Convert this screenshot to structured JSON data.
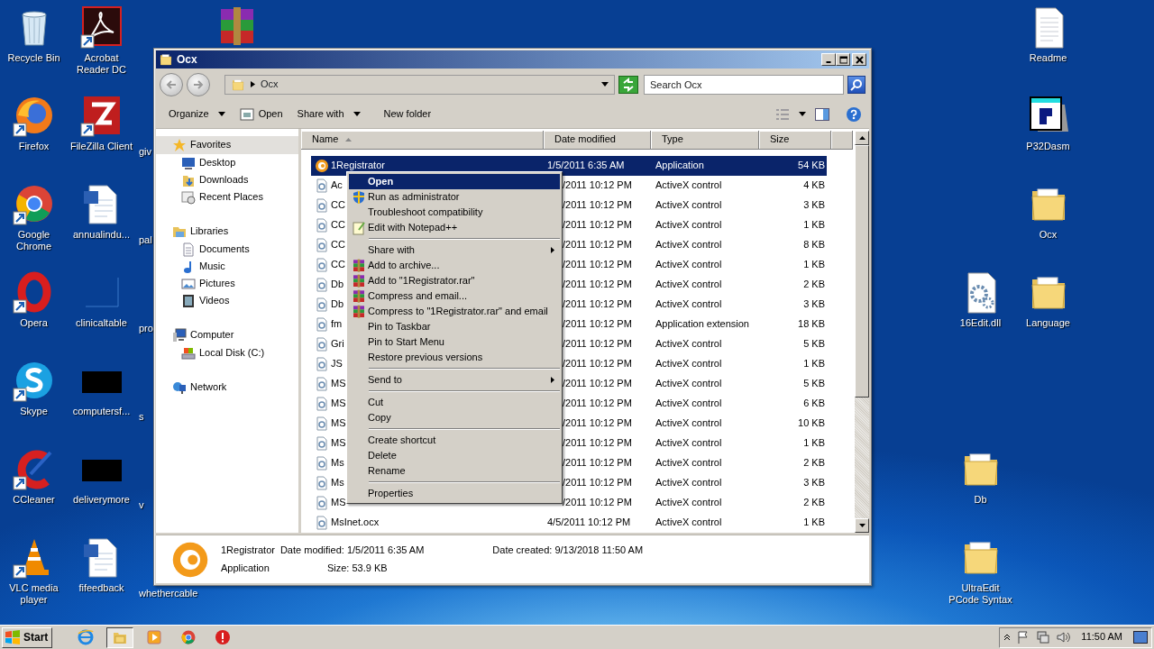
{
  "desktop": {
    "left_columns": [
      [
        {
          "label": "Recycle Bin",
          "kind": "recycle",
          "shortcut": false
        },
        {
          "label": "Firefox",
          "kind": "firefox",
          "shortcut": true
        },
        {
          "label": "Google Chrome",
          "kind": "chrome",
          "shortcut": true
        },
        {
          "label": "Opera",
          "kind": "opera",
          "shortcut": true
        },
        {
          "label": "Skype",
          "kind": "skype",
          "shortcut": true
        },
        {
          "label": "CCleaner",
          "kind": "ccleaner",
          "shortcut": true
        },
        {
          "label": "VLC media player",
          "kind": "vlc",
          "shortcut": true
        }
      ],
      [
        {
          "label": "Acrobat Reader DC",
          "kind": "acrobat",
          "shortcut": true
        },
        {
          "label": "FileZilla Client",
          "kind": "filezilla",
          "shortcut": true
        },
        {
          "label": "annualindu...",
          "kind": "word",
          "shortcut": false
        },
        {
          "label": "clinicaltable",
          "kind": "blank",
          "shortcut": false
        },
        {
          "label": "computersf...",
          "kind": "black",
          "shortcut": false
        },
        {
          "label": "deliverymore",
          "kind": "black",
          "shortcut": false
        },
        {
          "label": "fifeedback",
          "kind": "word",
          "shortcut": false
        }
      ],
      [
        null,
        {
          "label": "giv"
        },
        {
          "label": "pal"
        },
        {
          "label": "pro"
        },
        {
          "label": "s"
        },
        {
          "label": "v"
        },
        {
          "label": "whethercable"
        }
      ],
      [
        {
          "kind": "winrar",
          "shortcut": false
        }
      ]
    ],
    "right_columns": [
      [
        null,
        null,
        null,
        {
          "label": "16Edit.dll",
          "kind": "dll",
          "shortcut": false
        },
        null,
        {
          "label": "Db",
          "kind": "folder",
          "shortcut": false
        },
        {
          "label": "UltraEdit PCode Syntax",
          "kind": "folder",
          "shortcut": false
        }
      ],
      [
        {
          "label": "Readme",
          "kind": "text",
          "shortcut": false
        },
        {
          "label": "P32Dasm",
          "kind": "p32",
          "shortcut": false
        },
        {
          "label": "Ocx",
          "kind": "folder",
          "shortcut": false
        },
        {
          "label": "Language",
          "kind": "folder",
          "shortcut": false
        }
      ]
    ]
  },
  "window": {
    "title": "Ocx",
    "address": "Ocx",
    "search": {
      "placeholder": "Search Ocx"
    },
    "toolbar": [
      {
        "label": "Organize",
        "kind": "menu"
      },
      {
        "label": "Open",
        "kind": "icon_button"
      },
      {
        "label": "Share with",
        "kind": "menu"
      },
      {
        "label": "New folder",
        "kind": "plain"
      }
    ],
    "nav": [
      {
        "label": "Favorites",
        "kind": "star",
        "selected": true,
        "children": [
          {
            "label": "Desktop",
            "kind": "desktop",
            "selected": false
          },
          {
            "label": "Downloads",
            "kind": "downloads",
            "selected": false
          },
          {
            "label": "Recent Places",
            "kind": "recent",
            "selected": false
          }
        ]
      },
      {
        "label": "Libraries",
        "kind": "library",
        "selected": false,
        "children": [
          {
            "label": "Documents",
            "kind": "documents",
            "selected": false
          },
          {
            "label": "Music",
            "kind": "music",
            "selected": false
          },
          {
            "label": "Pictures",
            "kind": "pictures",
            "selected": false
          },
          {
            "label": "Videos",
            "kind": "videos",
            "selected": false
          }
        ]
      },
      {
        "label": "Computer",
        "kind": "computer",
        "selected": false,
        "children": [
          {
            "label": "Local Disk (C:)",
            "kind": "disk",
            "selected": false
          }
        ]
      },
      {
        "label": "Network",
        "kind": "network",
        "selected": false
      }
    ],
    "columns": [
      {
        "label": "Name",
        "sorted": true
      },
      {
        "label": "Date modified",
        "sorted": false
      },
      {
        "label": "Type",
        "sorted": false
      },
      {
        "label": "Size",
        "sorted": false
      }
    ],
    "rows": [
      {
        "name": "1Registrator",
        "date": "1/5/2011 6:35 AM",
        "type": "Application",
        "size": "54 KB",
        "kind": "app",
        "selected": true,
        "partly_covered": false
      },
      {
        "name": "Ac",
        "date": "/2011 10:12 PM",
        "type": "ActiveX control",
        "size": "4 KB",
        "kind": "ocx",
        "selected": false,
        "partly_covered": true
      },
      {
        "name": "CC",
        "date": "/2011 10:12 PM",
        "type": "ActiveX control",
        "size": "3 KB",
        "kind": "ocx",
        "selected": false,
        "partly_covered": true
      },
      {
        "name": "CC",
        "date": "/2011 10:12 PM",
        "type": "ActiveX control",
        "size": "1 KB",
        "kind": "ocx",
        "selected": false,
        "partly_covered": true
      },
      {
        "name": "CC",
        "date": "/2011 10:12 PM",
        "type": "ActiveX control",
        "size": "8 KB",
        "kind": "ocx",
        "selected": false,
        "partly_covered": true
      },
      {
        "name": "CC",
        "date": "/2011 10:12 PM",
        "type": "ActiveX control",
        "size": "1 KB",
        "kind": "ocx",
        "selected": false,
        "partly_covered": true
      },
      {
        "name": "Db",
        "date": "/2011 10:12 PM",
        "type": "ActiveX control",
        "size": "2 KB",
        "kind": "ocx",
        "selected": false,
        "partly_covered": true
      },
      {
        "name": "Db",
        "date": "/2011 10:12 PM",
        "type": "ActiveX control",
        "size": "3 KB",
        "kind": "ocx",
        "selected": false,
        "partly_covered": true
      },
      {
        "name": "fm",
        "date": "/2011 10:12 PM",
        "type": "Application extension",
        "size": "18 KB",
        "kind": "ocx",
        "selected": false,
        "partly_covered": true
      },
      {
        "name": "Gri",
        "date": "/2011 10:12 PM",
        "type": "ActiveX control",
        "size": "5 KB",
        "kind": "ocx",
        "selected": false,
        "partly_covered": true
      },
      {
        "name": "JS",
        "date": "/2011 10:12 PM",
        "type": "ActiveX control",
        "size": "1 KB",
        "kind": "ocx",
        "selected": false,
        "partly_covered": true
      },
      {
        "name": "MS",
        "date": "/2011 10:12 PM",
        "type": "ActiveX control",
        "size": "5 KB",
        "kind": "ocx",
        "selected": false,
        "partly_covered": true
      },
      {
        "name": "MS",
        "date": "/2011 10:12 PM",
        "type": "ActiveX control",
        "size": "6 KB",
        "kind": "ocx",
        "selected": false,
        "partly_covered": true
      },
      {
        "name": "MS",
        "date": "/2011 10:12 PM",
        "type": "ActiveX control",
        "size": "10 KB",
        "kind": "ocx",
        "selected": false,
        "partly_covered": true
      },
      {
        "name": "MS",
        "date": "/2011 10:12 PM",
        "type": "ActiveX control",
        "size": "1 KB",
        "kind": "ocx",
        "selected": false,
        "partly_covered": true
      },
      {
        "name": "Ms",
        "date": "/2011 10:12 PM",
        "type": "ActiveX control",
        "size": "2 KB",
        "kind": "ocx",
        "selected": false,
        "partly_covered": true
      },
      {
        "name": "Ms",
        "date": "/2011 10:12 PM",
        "type": "ActiveX control",
        "size": "3 KB",
        "kind": "ocx",
        "selected": false,
        "partly_covered": true
      },
      {
        "name": "MS",
        "date": "/2011 10:12 PM",
        "type": "ActiveX control",
        "size": "2 KB",
        "kind": "ocx",
        "selected": false,
        "partly_covered": true
      },
      {
        "name": "MsInet.ocx",
        "date": "4/5/2011 10:12 PM",
        "type": "ActiveX control",
        "size": "1 KB",
        "kind": "ocx",
        "selected": false,
        "partly_covered": false
      }
    ],
    "details": {
      "name": "1Registrator",
      "type": "Application",
      "fields": [
        {
          "label": "Date modified:",
          "value": "1/5/2011 6:35 AM"
        },
        {
          "label": "Size:",
          "value": "53.9 KB"
        },
        {
          "label": "Date created:",
          "value": "9/13/2018 11:50 AM"
        }
      ]
    },
    "context_menu": [
      {
        "kind": "command",
        "label": "Open",
        "default": true,
        "selected": true,
        "submenu": false
      },
      {
        "kind": "admin",
        "label": "Run as administrator",
        "default": false,
        "selected": false,
        "submenu": false
      },
      {
        "kind": "command",
        "label": "Troubleshoot compatibility",
        "default": false,
        "selected": false,
        "submenu": false
      },
      {
        "kind": "editor",
        "label": "Edit with Notepad++",
        "default": false,
        "selected": false,
        "submenu": false
      },
      {
        "kind": "separator"
      },
      {
        "kind": "command",
        "label": "Share with",
        "default": false,
        "selected": false,
        "submenu": true
      },
      {
        "kind": "archive",
        "label": "Add to archive...",
        "default": false,
        "selected": false,
        "submenu": false
      },
      {
        "kind": "archive",
        "label": "Add to \"1Registrator.rar\"",
        "default": false,
        "selected": false,
        "submenu": false
      },
      {
        "kind": "archive",
        "label": "Compress and email...",
        "default": false,
        "selected": false,
        "submenu": false
      },
      {
        "kind": "archive",
        "label": "Compress to \"1Registrator.rar\" and email",
        "default": false,
        "selected": false,
        "submenu": false
      },
      {
        "kind": "command",
        "label": "Pin to Taskbar",
        "default": false,
        "selected": false,
        "submenu": false
      },
      {
        "kind": "command",
        "label": "Pin to Start Menu",
        "default": false,
        "selected": false,
        "submenu": false
      },
      {
        "kind": "command",
        "label": "Restore previous versions",
        "default": false,
        "selected": false,
        "submenu": false
      },
      {
        "kind": "separator"
      },
      {
        "kind": "command",
        "label": "Send to",
        "default": false,
        "selected": false,
        "submenu": true
      },
      {
        "kind": "separator"
      },
      {
        "kind": "command",
        "label": "Cut",
        "default": false,
        "selected": false,
        "submenu": false
      },
      {
        "kind": "command",
        "label": "Copy",
        "default": false,
        "selected": false,
        "submenu": false
      },
      {
        "kind": "separator"
      },
      {
        "kind": "command",
        "label": "Create shortcut",
        "default": false,
        "selected": false,
        "submenu": false
      },
      {
        "kind": "command",
        "label": "Delete",
        "default": false,
        "selected": false,
        "submenu": false
      },
      {
        "kind": "command",
        "label": "Rename",
        "default": false,
        "selected": false,
        "submenu": false
      },
      {
        "kind": "separator"
      },
      {
        "kind": "command",
        "label": "Properties",
        "default": false,
        "selected": false,
        "submenu": false
      }
    ]
  },
  "taskbar": {
    "start": "Start",
    "apps": [
      {
        "kind": "ie",
        "active": false
      },
      {
        "kind": "explorer",
        "active": true
      },
      {
        "kind": "media",
        "active": false
      },
      {
        "kind": "chrome",
        "active": false
      },
      {
        "kind": "stop",
        "active": false
      }
    ],
    "clock": "11:50 AM"
  }
}
